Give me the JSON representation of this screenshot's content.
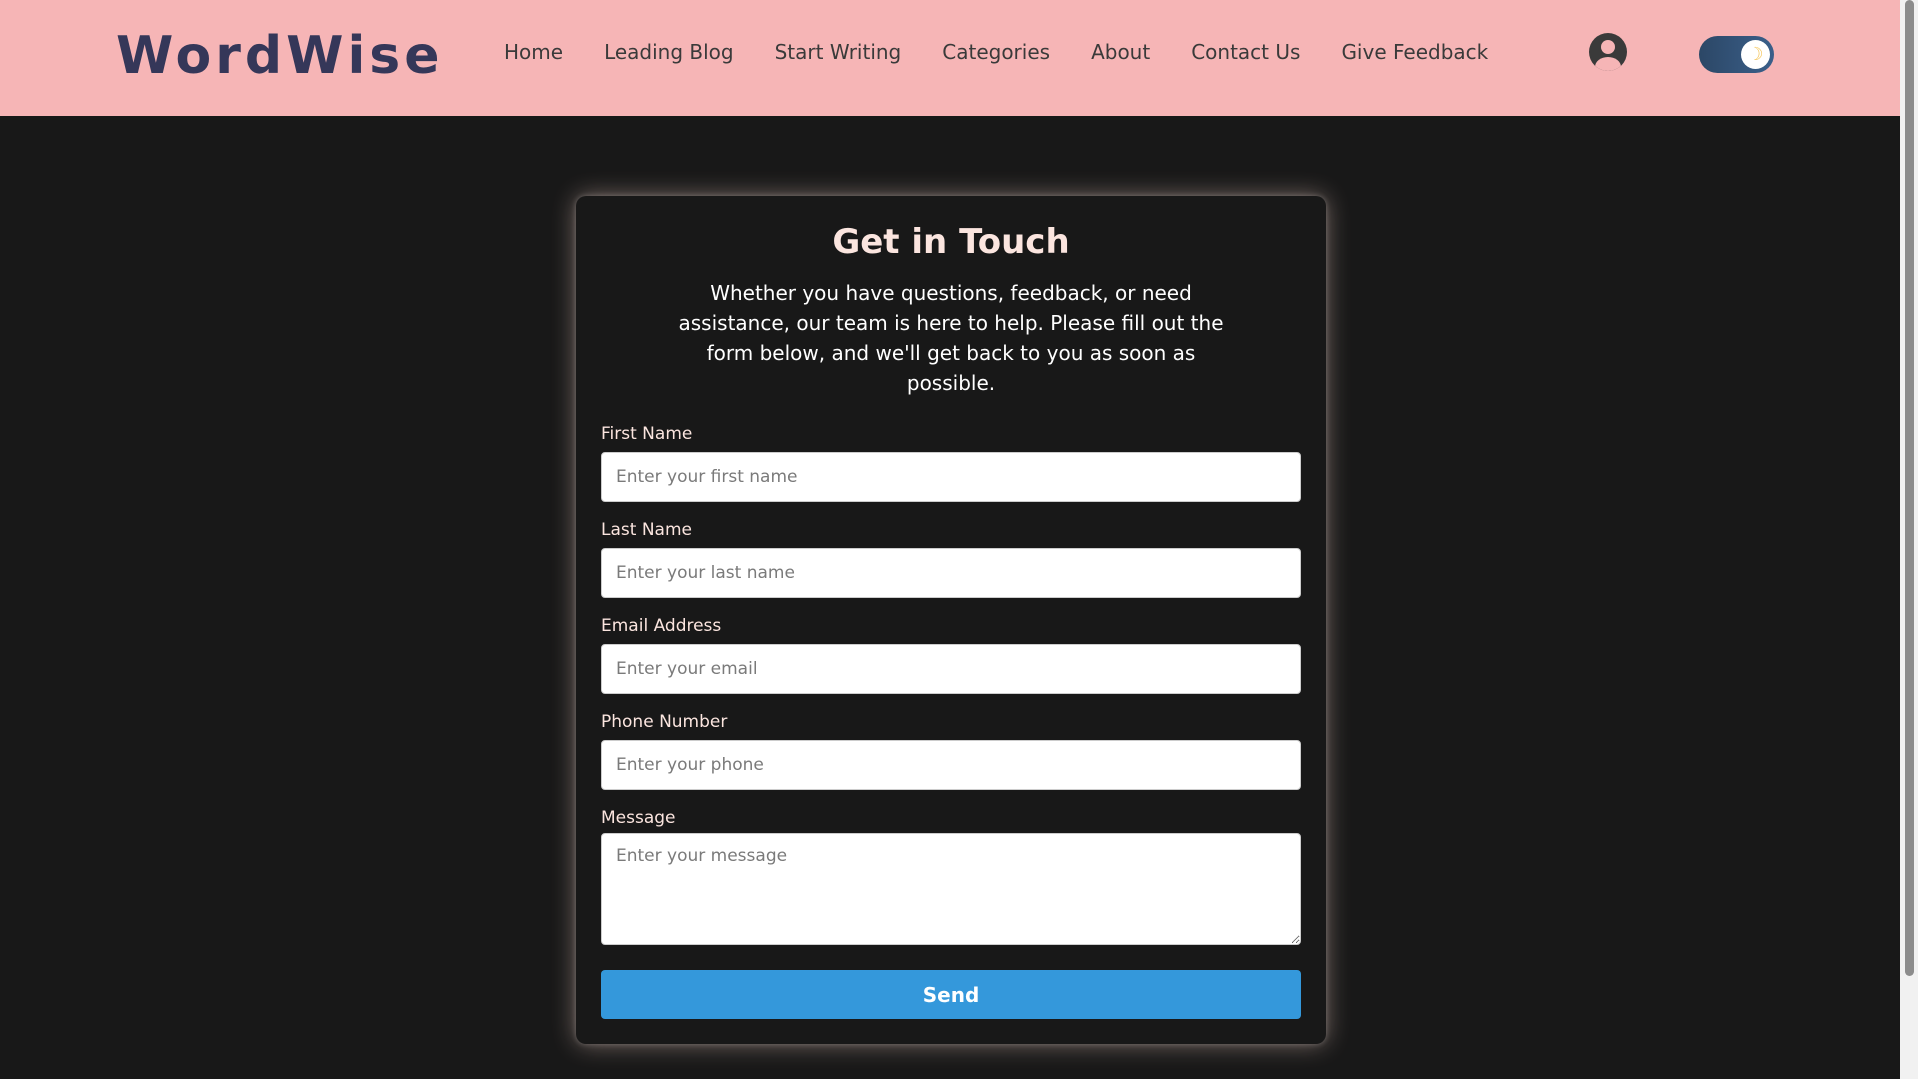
{
  "header": {
    "logo": "WordWise",
    "nav": [
      {
        "label": "Home"
      },
      {
        "label": "Leading Blog"
      },
      {
        "label": "Start Writing"
      },
      {
        "label": "Categories"
      },
      {
        "label": "About"
      },
      {
        "label": "Contact Us"
      },
      {
        "label": "Give Feedback"
      }
    ],
    "user_icon": "user-circle-icon",
    "theme_toggle_icon": "moon-icon",
    "theme_toggle_glyph": "☽"
  },
  "form": {
    "title": "Get in Touch",
    "description": "Whether you have questions, feedback, or need assistance, our team is here to help. Please fill out the form below, and we'll get back to you as soon as possible.",
    "first_name": {
      "label": "First Name",
      "placeholder": "Enter your first name",
      "value": ""
    },
    "last_name": {
      "label": "Last Name",
      "placeholder": "Enter your last name",
      "value": ""
    },
    "email": {
      "label": "Email Address",
      "placeholder": "Enter your email",
      "value": ""
    },
    "phone": {
      "label": "Phone Number",
      "placeholder": "Enter your phone",
      "value": ""
    },
    "message": {
      "label": "Message",
      "placeholder": "Enter your message",
      "value": ""
    },
    "send_label": "Send"
  },
  "colors": {
    "header_bg": "#f6b5b6",
    "logo": "#353759",
    "page_bg": "#181818",
    "title": "#fbe5df",
    "send_button": "#3498db",
    "toggle": "#2c4766"
  }
}
